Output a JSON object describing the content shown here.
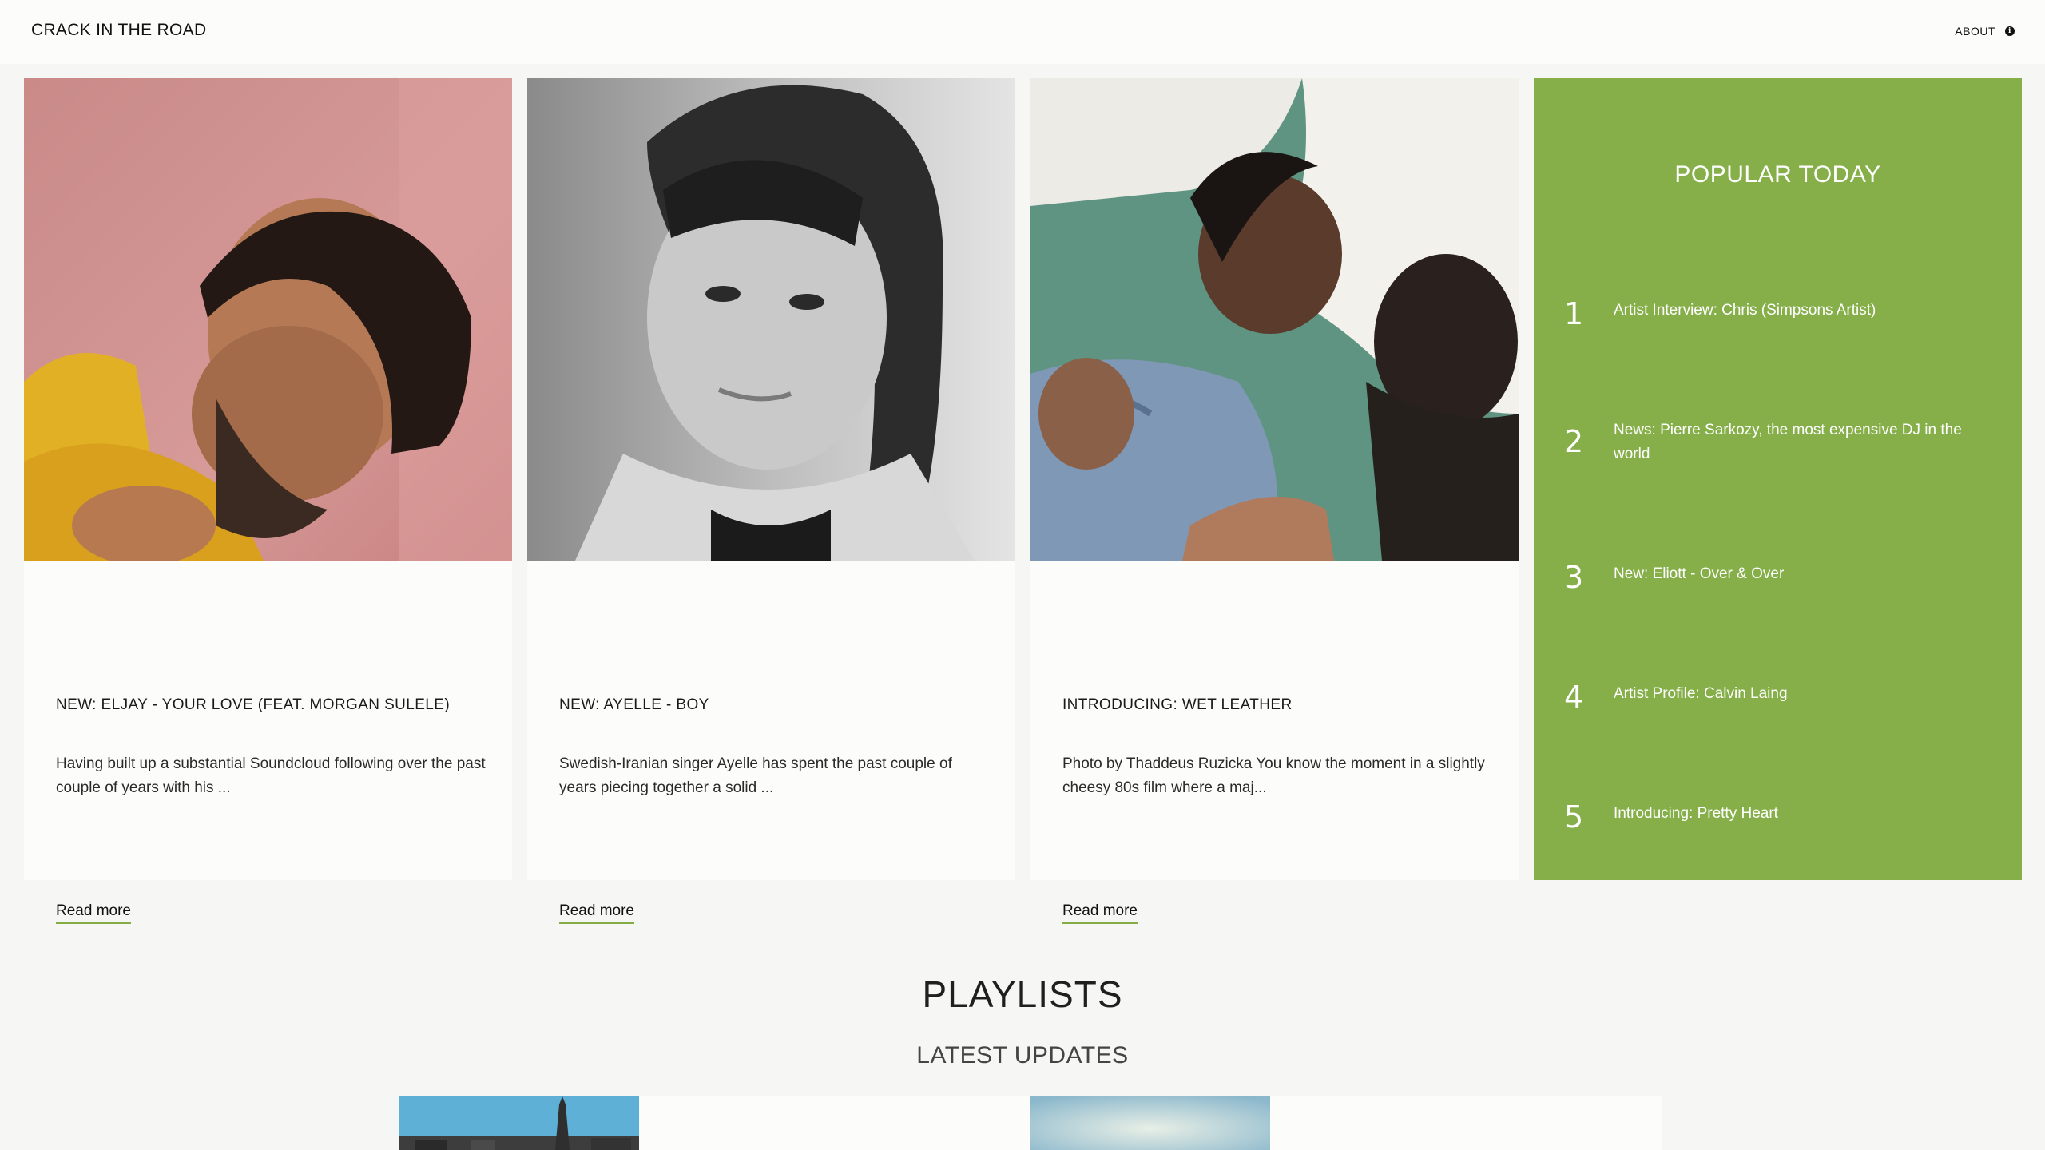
{
  "header": {
    "brand": "CRACK IN THE ROAD",
    "about_label": "ABOUT",
    "about_icon": "info-icon"
  },
  "cards": [
    {
      "title": "NEW: ELJAY - YOUR LOVE (FEAT. MORGAN SULELE)",
      "excerpt": "Having built up a substantial Soundcloud following over the past couple of years with his ...",
      "read_more": "Read more"
    },
    {
      "title": "NEW: AYELLE - BOY",
      "excerpt": "Swedish-Iranian singer Ayelle has spent the past couple of years piecing together a solid ...",
      "read_more": "Read more"
    },
    {
      "title": "INTRODUCING: WET LEATHER",
      "excerpt": "Photo by Thaddeus Ruzicka You know the moment in a slightly cheesy 80s film where a maj...",
      "read_more": "Read more"
    }
  ],
  "popular": {
    "title": "POPULAR TODAY",
    "items": [
      {
        "num": "1",
        "label": "Artist Interview: Chris (Simpsons Artist)"
      },
      {
        "num": "2",
        "label": "News: Pierre Sarkozy, the most expensive DJ in the world"
      },
      {
        "num": "3",
        "label": "New: Eliott - Over & Over"
      },
      {
        "num": "4",
        "label": "Artist Profile: Calvin Laing"
      },
      {
        "num": "5",
        "label": "Introducing: Pretty Heart"
      }
    ]
  },
  "playlists": {
    "title": "PLAYLISTS",
    "subtitle": "LATEST UPDATES"
  },
  "colors": {
    "accent": "#86af4a",
    "background": "#f6f6f4",
    "card": "#fcfcfb"
  }
}
